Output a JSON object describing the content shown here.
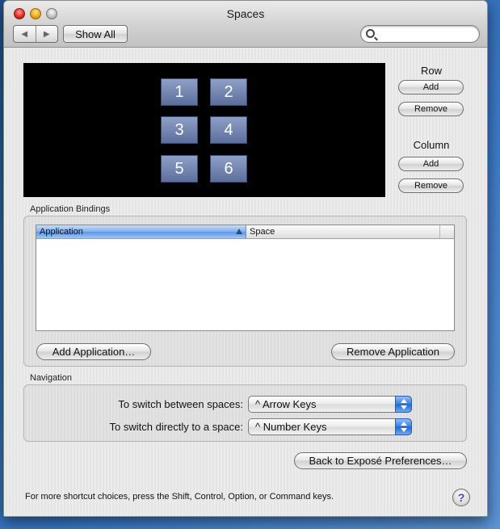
{
  "window": {
    "title": "Spaces"
  },
  "toolbar": {
    "back_icon": "left-triangle",
    "forward_icon": "right-triangle",
    "show_all_label": "Show All",
    "search_value": "",
    "search_placeholder": ""
  },
  "spaces": {
    "tiles": [
      "1",
      "2",
      "3",
      "4",
      "5",
      "6"
    ],
    "rows": 3,
    "columns": 2
  },
  "row_controls": {
    "title": "Row",
    "add_label": "Add",
    "remove_label": "Remove"
  },
  "column_controls": {
    "title": "Column",
    "add_label": "Add",
    "remove_label": "Remove"
  },
  "bindings": {
    "section_title": "Application Bindings",
    "columns": [
      "Application",
      "Space"
    ],
    "rows": [],
    "add_label": "Add Application…",
    "remove_label": "Remove Application"
  },
  "navigation": {
    "section_title": "Navigation",
    "switch_between_label": "To switch between spaces:",
    "switch_between_value": "^ Arrow Keys",
    "switch_direct_label": "To switch directly to a space:",
    "switch_direct_value": "^ Number Keys"
  },
  "back_to_expose_label": "Back to Exposé Preferences…",
  "footer_text": "For more shortcut choices, press the Shift, Control, Option, or Command keys.",
  "help_label": "?",
  "colors": {
    "accent": "#3b82e0",
    "tile": "#6f82ad",
    "grid_bg": "#000000"
  }
}
